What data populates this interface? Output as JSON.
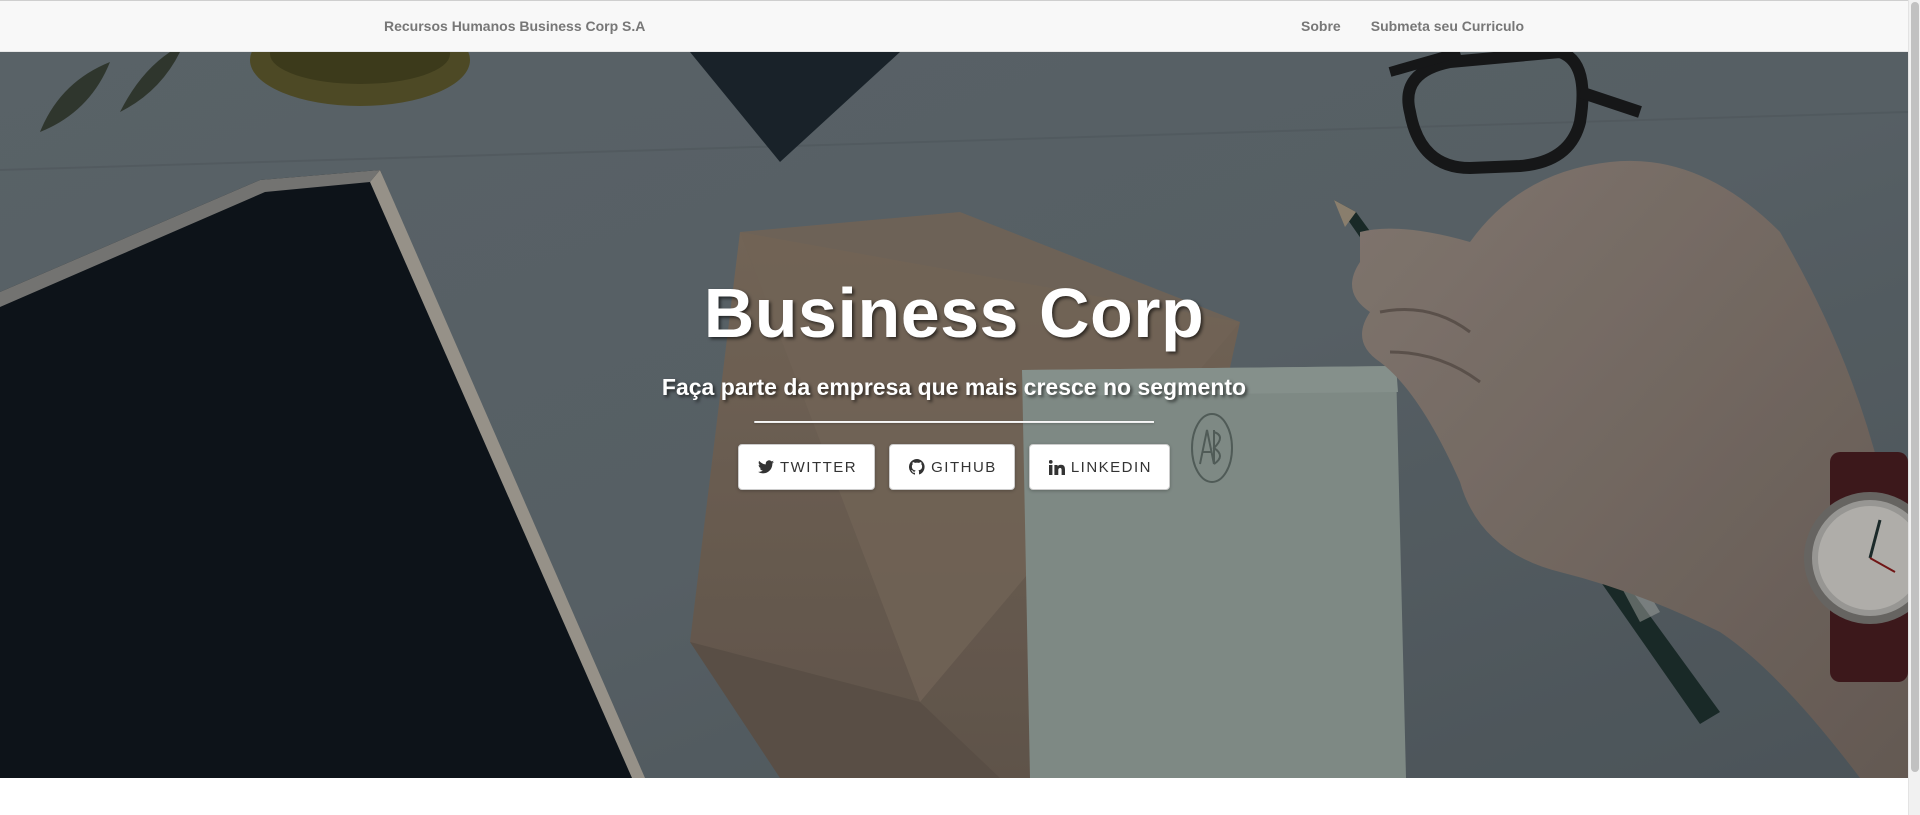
{
  "navbar": {
    "brand": "Recursos Humanos Business Corp S.A",
    "links": [
      {
        "label": "Sobre"
      },
      {
        "label": "Submeta seu Curriculo"
      }
    ]
  },
  "hero": {
    "title": "Business Corp",
    "subtitle": "Faça parte da empresa que mais cresce no segmento",
    "buttons": [
      {
        "label": "TWITTER",
        "icon": "twitter-icon"
      },
      {
        "label": "GITHUB",
        "icon": "github-icon"
      },
      {
        "label": "LINKEDIN",
        "icon": "linkedin-icon"
      }
    ]
  },
  "colors": {
    "navbar_bg": "#f8f8f8",
    "nav_text": "#777777",
    "hero_text": "#ffffff",
    "button_text": "#333333"
  }
}
